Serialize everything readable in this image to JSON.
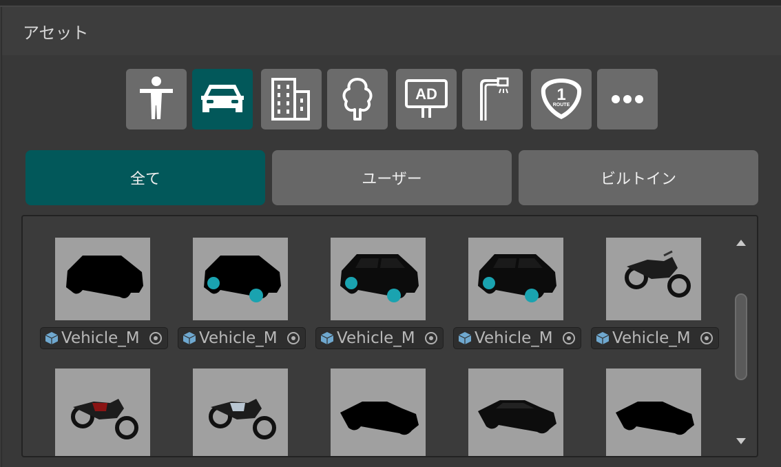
{
  "panel": {
    "title": "アセット"
  },
  "categories": [
    {
      "icon": "person-icon",
      "active": false
    },
    {
      "icon": "car-icon",
      "active": true
    },
    {
      "icon": "building-icon",
      "active": false
    },
    {
      "icon": "tree-icon",
      "active": false
    },
    {
      "icon": "billboard-ad-icon",
      "ad_text": "AD",
      "active": false
    },
    {
      "icon": "street-lamp-icon",
      "active": false
    },
    {
      "icon": "route-sign-icon",
      "route_number": "1",
      "route_text": "ROUTE",
      "active": false
    },
    {
      "icon": "more-icon",
      "active": false
    }
  ],
  "filters": [
    {
      "label": "全て",
      "active": true
    },
    {
      "label": "ユーザー",
      "active": false
    },
    {
      "label": "ビルトイン",
      "active": false
    }
  ],
  "assets_row1": [
    {
      "name": "Vehicle_M",
      "thumb": "suv-silhouette"
    },
    {
      "name": "Vehicle_M",
      "thumb": "suv-silhouette-cyan-wheels"
    },
    {
      "name": "Vehicle_M",
      "thumb": "suv-dark-cyan-wheels"
    },
    {
      "name": "Vehicle_M",
      "thumb": "suv-dark-cyan-wheels"
    },
    {
      "name": "Vehicle_M",
      "thumb": "motorcycle-dark"
    }
  ],
  "assets_row2": [
    {
      "thumb": "motorcycle-red"
    },
    {
      "thumb": "motorcycle-silver"
    },
    {
      "thumb": "sedan-silhouette"
    },
    {
      "thumb": "sedan-dark"
    },
    {
      "thumb": "sedan-silhouette"
    }
  ],
  "colors": {
    "accent": "#02585a",
    "button": "#6b6b6b",
    "panel": "#383838",
    "cube": "#6fa8cf",
    "wheel": "#1aa3b0"
  }
}
